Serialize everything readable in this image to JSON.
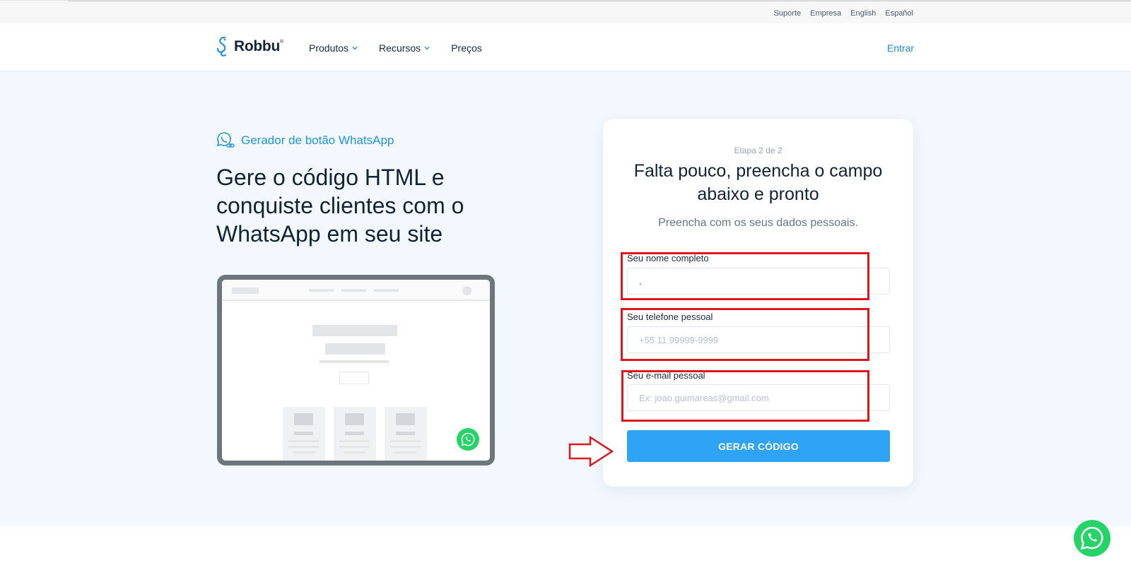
{
  "topbar": {
    "links": [
      "Suporte",
      "Empresa",
      "English",
      "Español"
    ]
  },
  "header": {
    "logo_text": "Robbu",
    "nav": [
      {
        "label": "Produtos",
        "has_dropdown": true
      },
      {
        "label": "Recursos",
        "has_dropdown": true
      },
      {
        "label": "Preços",
        "has_dropdown": false
      }
    ],
    "login_label": "Entrar",
    "accent_color": "#2293e0"
  },
  "hero": {
    "eyebrow": "Gerador de botão WhatsApp",
    "title": "Gere o código HTML e conquiste clientes com o WhatsApp em seu site"
  },
  "form": {
    "step": "Etapa 2 de 2",
    "title": "Falta pouco, preencha o campo abaixo e pronto",
    "subtitle": "Preencha com os seus dados pessoais.",
    "fields": [
      {
        "label": "Seu nome completo",
        "value": ".",
        "placeholder": ""
      },
      {
        "label": "Seu telefone pessoal",
        "value": "",
        "placeholder": "+55 11 99999-9999"
      },
      {
        "label": "Seu e-mail pessoal",
        "value": "",
        "placeholder": "Ex: joao.guimareas@gmail.com"
      }
    ],
    "submit_label": "GERAR CÓDIGO",
    "button_color": "#2fa3f5"
  },
  "annotations": {
    "color": "#e0161f",
    "highlighted_fields": 3,
    "arrow_target": "submit-button"
  },
  "floating_button": {
    "icon": "whatsapp-icon",
    "color": "#25d366"
  }
}
